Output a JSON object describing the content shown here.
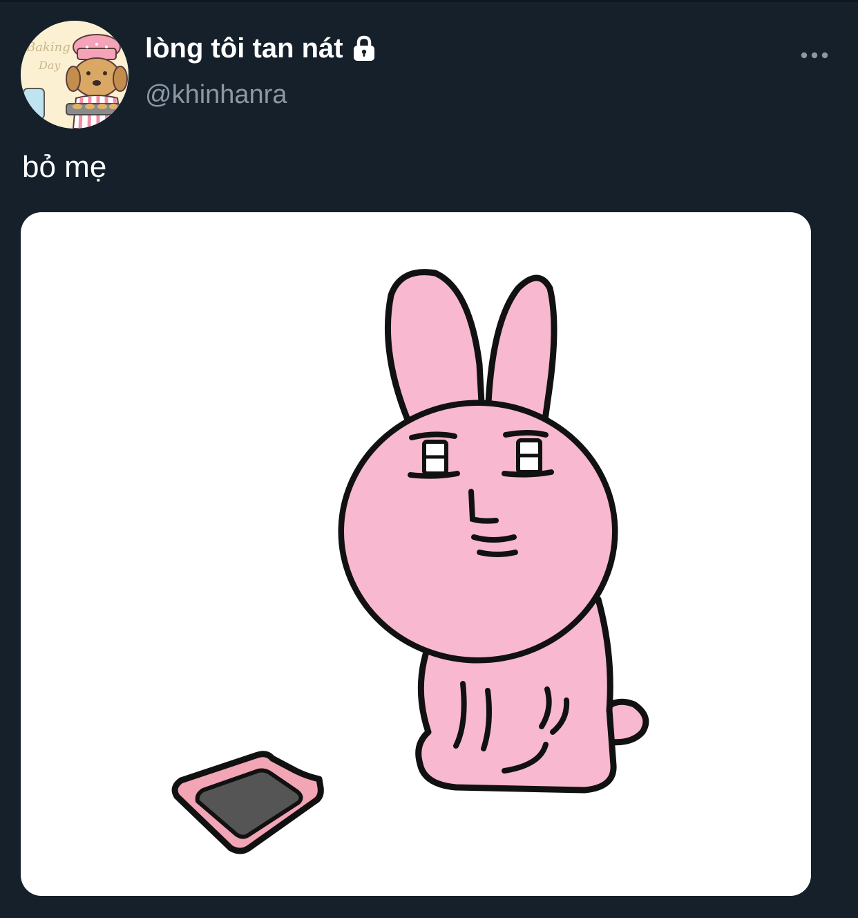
{
  "tweet": {
    "author": {
      "display_name": "lòng tôi tan nát",
      "handle": "@khinhanra",
      "protected_icon": "lock-icon",
      "avatar": {
        "description_icon": "avatar-baking-dog",
        "lettering": "Baking Day"
      }
    },
    "text": "bỏ mẹ",
    "more_icon": "more-dots-icon",
    "media": {
      "kind": "image",
      "subject_icon": "pink-rabbit-sticker"
    }
  },
  "colors": {
    "background": "#15202b",
    "primary_text": "#ffffff",
    "secondary_text": "#8b98a5",
    "rabbit_fill": "#f7b8d0",
    "outline": "#111111"
  }
}
